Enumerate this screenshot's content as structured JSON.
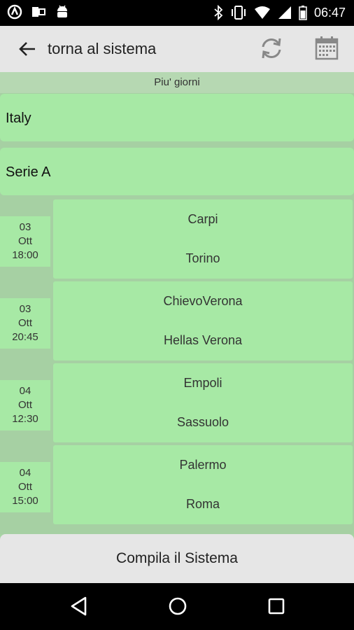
{
  "status_bar": {
    "time": "06:47",
    "left_icons": [
      "app-icon",
      "office-icon",
      "android-icon"
    ],
    "right_icons": [
      "bluetooth-icon",
      "vibrate-icon",
      "wifi-icon",
      "signal-icon",
      "battery-icon"
    ]
  },
  "app_bar": {
    "title": "torna al sistema"
  },
  "subheader": "Piu' giorni",
  "country": "Italy",
  "league": "Serie  A",
  "matches": [
    {
      "day": "03",
      "month": "Ott",
      "time": "18:00",
      "home": "Carpi",
      "away": "Torino"
    },
    {
      "day": "03",
      "month": "Ott",
      "time": "20:45",
      "home": "ChievoVerona",
      "away": "Hellas  Verona"
    },
    {
      "day": "04",
      "month": "Ott",
      "time": "12:30",
      "home": "Empoli",
      "away": "Sassuolo"
    },
    {
      "day": "04",
      "month": "Ott",
      "time": "15:00",
      "home": "Palermo",
      "away": "Roma"
    }
  ],
  "footer_button": "Compila il Sistema",
  "colors": {
    "card_green": "#a7e9a5",
    "background_green": "#a6d0a3",
    "bar_grey": "#e6e6e6"
  }
}
